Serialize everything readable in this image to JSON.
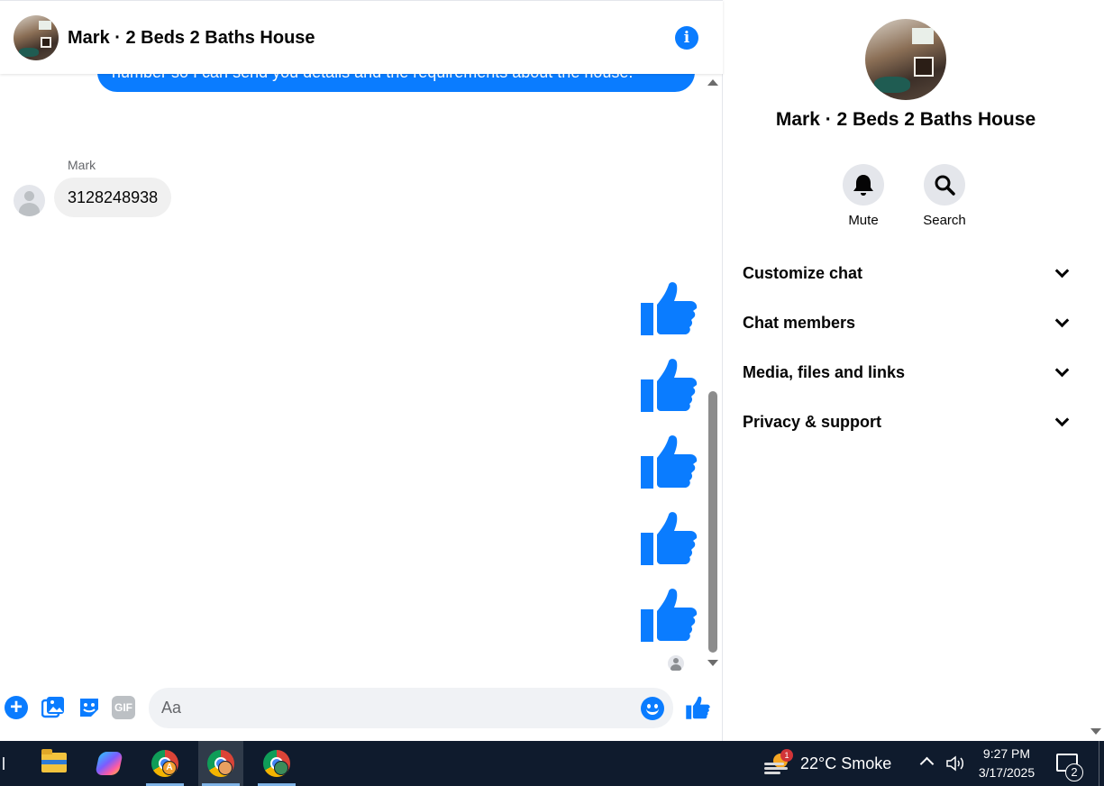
{
  "chat": {
    "title": "Mark · 2 Beds 2 Baths House",
    "outgoing_partial_text": "number so I can send you details and the requirements about the house.",
    "incoming": {
      "sender": "Mark",
      "text": "3128248938"
    },
    "like_count": 5
  },
  "composer": {
    "placeholder": "Aa",
    "gif_label": "GIF"
  },
  "details": {
    "title": "Mark · 2 Beds 2 Baths House",
    "actions": [
      {
        "label": "Mute",
        "icon": "bell-icon"
      },
      {
        "label": "Search",
        "icon": "search-icon"
      }
    ],
    "sections": [
      {
        "label": "Customize chat"
      },
      {
        "label": "Chat members"
      },
      {
        "label": "Media, files and links"
      },
      {
        "label": "Privacy & support"
      }
    ]
  },
  "taskbar": {
    "weather": "22°C  Smoke",
    "weather_badge": "1",
    "time": "9:27 PM",
    "date": "3/17/2025",
    "notifications": "2",
    "profile_badge": "A"
  },
  "colors": {
    "accent": "#0a7cff",
    "incoming_bubble": "#f0f0f0",
    "taskbar": "#0f1b2d"
  }
}
